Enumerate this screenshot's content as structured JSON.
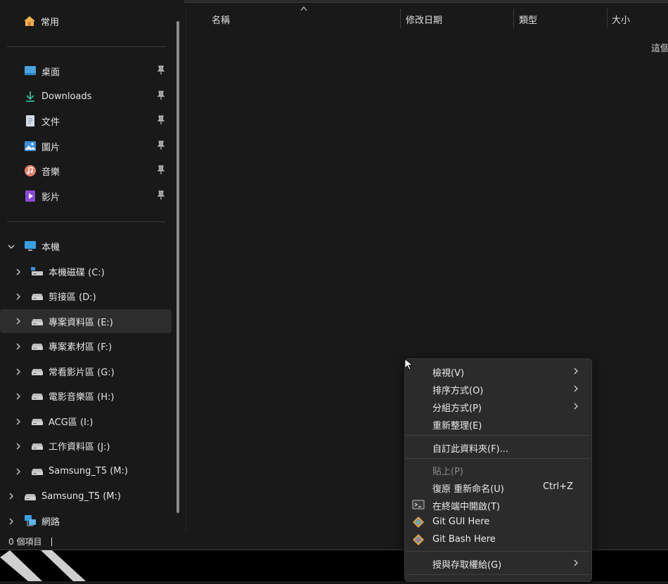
{
  "sidebar": {
    "home": {
      "label": "常用"
    },
    "quick_access": [
      {
        "label": "桌面",
        "icon": "desktop-icon"
      },
      {
        "label": "Downloads",
        "icon": "download-icon"
      },
      {
        "label": "文件",
        "icon": "document-icon"
      },
      {
        "label": "圖片",
        "icon": "pictures-icon"
      },
      {
        "label": "音樂",
        "icon": "music-icon"
      },
      {
        "label": "影片",
        "icon": "videos-icon"
      }
    ],
    "this_pc": {
      "label": "本機"
    },
    "drives": [
      {
        "label": "本機磁碟 (C:)"
      },
      {
        "label": "剪接區 (D:)"
      },
      {
        "label": "專案資料區 (E:)"
      },
      {
        "label": "專案素材區 (F:)"
      },
      {
        "label": "常看影片區 (G:)"
      },
      {
        "label": "電影音樂區 (H:)"
      },
      {
        "label": "ACG區 (I:)"
      },
      {
        "label": "工作資料區 (J:)"
      },
      {
        "label": "Samsung_T5 (M:)"
      }
    ],
    "external_drive": {
      "label": "Samsung_T5 (M:)"
    },
    "network": {
      "label": "網路"
    }
  },
  "columns": {
    "name": "名稱",
    "modified": "修改日期",
    "type": "類型",
    "size": "大小"
  },
  "content": {
    "empty_message": "這個"
  },
  "status": {
    "items": "0 個項目"
  },
  "context_menu": {
    "items": [
      {
        "label": "檢視(V)"
      },
      {
        "label": "排序方式(O)"
      },
      {
        "label": "分組方式(P)"
      },
      {
        "label": "重新整理(E)"
      },
      {
        "label": "自訂此資料夾(F)..."
      },
      {
        "label": "貼上(P)"
      },
      {
        "label": "復原 重新命名(U)",
        "shortcut": "Ctrl+Z"
      },
      {
        "label": "在終端中開啟(T)"
      },
      {
        "label": "Git GUI Here"
      },
      {
        "label": "Git Bash Here"
      },
      {
        "label": "授與存取權給(G)"
      }
    ]
  },
  "colors": {
    "background": "#191919",
    "menu": "#2b2b2b",
    "selected": "#2d2d2d"
  }
}
